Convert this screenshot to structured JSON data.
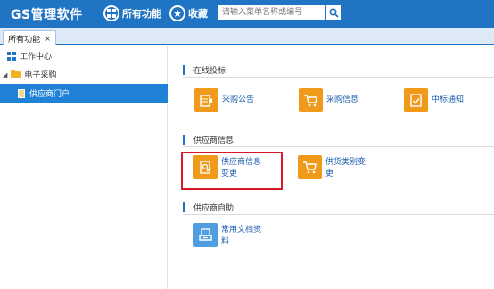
{
  "header": {
    "brand": "GS管理软件",
    "nav_all": "所有功能",
    "nav_fav": "收藏",
    "search_placeholder": "请输入菜单名称或编号"
  },
  "tabs": [
    {
      "label": "所有功能",
      "close": "×"
    }
  ],
  "sidebar": {
    "items": [
      {
        "label": "工作中心",
        "icon": "grid-icon"
      },
      {
        "label": "电子采购",
        "icon": "folder-icon",
        "expanded": true
      },
      {
        "label": "供应商门户",
        "icon": "document-icon",
        "active": true
      }
    ]
  },
  "sections": [
    {
      "title": "在线投标",
      "apps": [
        {
          "label": "采购公告",
          "icon": "announcement-icon",
          "color": "#ef9a1a"
        },
        {
          "label": "采购信息",
          "icon": "cart-icon",
          "color": "#ef9a1a"
        },
        {
          "label": "中标通知",
          "icon": "checklist-icon",
          "color": "#ef9a1a"
        }
      ]
    },
    {
      "title": "供应商信息",
      "apps": [
        {
          "label": "供应商信息变更",
          "label_line1": "供应商信息",
          "label_line2": "变更",
          "icon": "edit-document-icon",
          "color": "#ef9a1a",
          "highlighted": true
        },
        {
          "label": "供货类别变更",
          "label_line1": "供货类别变",
          "label_line2": "更",
          "icon": "cart-icon",
          "color": "#ef9a1a"
        }
      ]
    },
    {
      "title": "供应商自助",
      "apps": [
        {
          "label": "常用文档资料",
          "label_line1": "常用文档资",
          "label_line2": "料",
          "icon": "document-tray-icon",
          "color": "#4f9fe0"
        }
      ]
    }
  ],
  "colors": {
    "header_bg": "#1f74c4",
    "active_item_bg": "#1f82d6",
    "app_icon_orange": "#ef9a1a",
    "app_icon_blue": "#4f9fe0",
    "highlight_border": "#d8182a"
  }
}
